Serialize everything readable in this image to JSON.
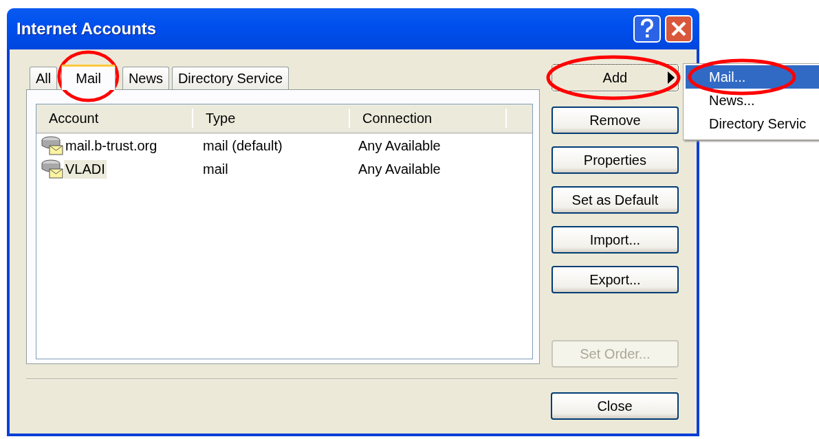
{
  "window": {
    "title": "Internet Accounts"
  },
  "tabs": [
    {
      "label": "All",
      "selected": false,
      "circled": false
    },
    {
      "label": "Mail",
      "selected": true,
      "circled": true
    },
    {
      "label": "News",
      "selected": false,
      "circled": false
    },
    {
      "label": "Directory Service",
      "selected": false,
      "circled": false
    }
  ],
  "table": {
    "columns": [
      "Account",
      "Type",
      "Connection"
    ],
    "rows": [
      {
        "account": "mail.b-trust.org",
        "type": "mail (default)",
        "connection": "Any Available",
        "selected": false
      },
      {
        "account": "VLADI",
        "type": "mail",
        "connection": "Any Available",
        "selected": true
      }
    ]
  },
  "buttons": [
    {
      "label": "Add",
      "kind": "submenu",
      "disabled": false,
      "circled": true
    },
    {
      "label": "Remove",
      "kind": "plain",
      "disabled": false,
      "circled": false
    },
    {
      "label": "Properties",
      "kind": "plain",
      "disabled": false,
      "circled": false
    },
    {
      "label": "Set as Default",
      "kind": "plain",
      "disabled": false,
      "circled": false
    },
    {
      "label": "Import...",
      "kind": "plain",
      "disabled": false,
      "circled": false
    },
    {
      "label": "Export...",
      "kind": "plain",
      "disabled": false,
      "circled": false
    },
    {
      "label": "Set Order...",
      "kind": "spaced",
      "disabled": true,
      "circled": false
    }
  ],
  "close_button": "Close",
  "add_menu": [
    {
      "label": "Mail...",
      "selected": true,
      "circled": true
    },
    {
      "label": "News...",
      "selected": false,
      "circled": false
    },
    {
      "label": "Directory Servic",
      "selected": false,
      "circled": false
    }
  ]
}
